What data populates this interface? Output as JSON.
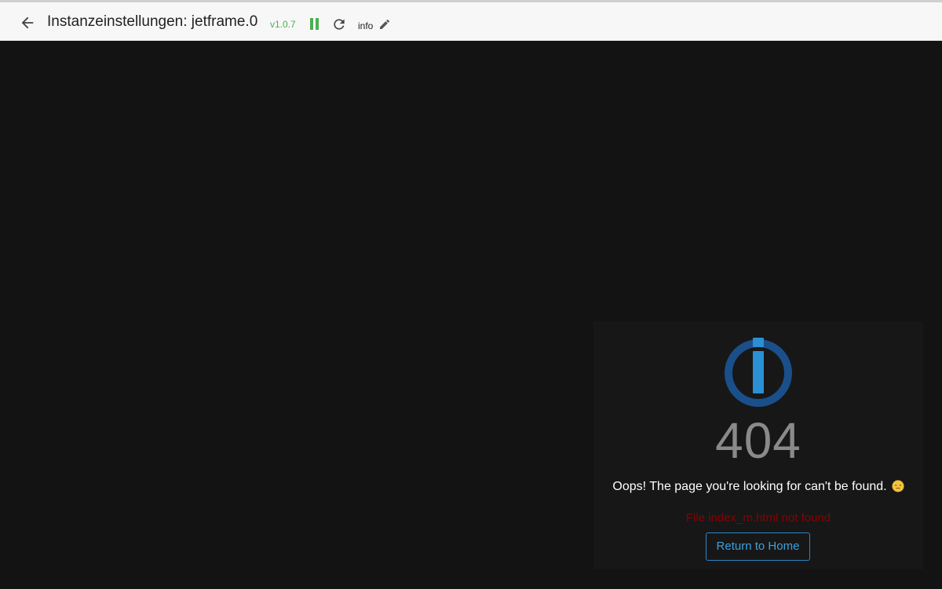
{
  "header": {
    "title": "Instanzeinstellungen: jetframe.0",
    "version": "v1.0.7",
    "info_label": "info",
    "status_color": "#4caf50",
    "icons": {
      "back": "arrow-left-icon",
      "pause": "pause-icon",
      "reload": "reload-icon",
      "edit": "pencil-icon"
    }
  },
  "error_page": {
    "code": "404",
    "message": "Oops! The page you're looking for can't be found.",
    "detail": "File index_m.html not found",
    "home_button_label": "Return to Home",
    "logo_icon": "iobroker-logo-icon",
    "emoji_icon": "pensive-face-emoji",
    "colors": {
      "logo": "#1a4f8a",
      "logo_bar": "#2a8fd4",
      "code": "#8a8a8a",
      "detail": "#8b0000",
      "button": "#3aa0e0"
    }
  }
}
